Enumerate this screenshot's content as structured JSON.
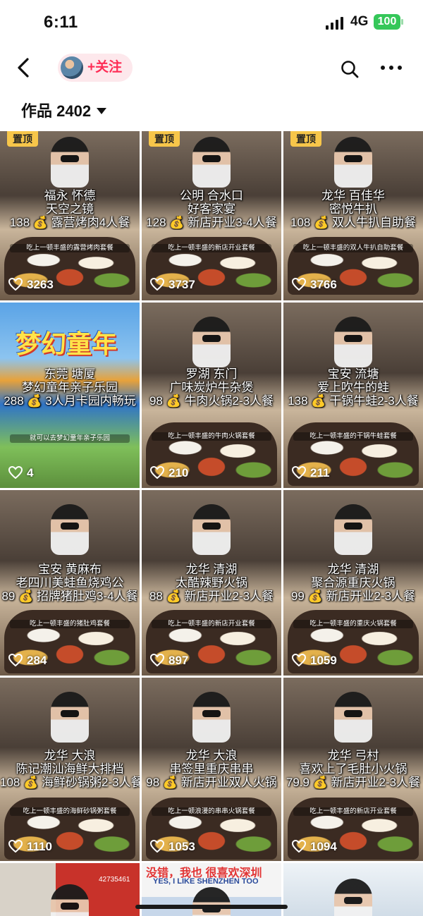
{
  "status_bar": {
    "time": "6:11",
    "network": "4G",
    "battery": "100"
  },
  "nav": {
    "follow_label": "+关注"
  },
  "works": {
    "label": "作品",
    "count": "2402"
  },
  "tiles": [
    {
      "pinned": "置顶",
      "line1": "福永 怀德",
      "line2": "天空之镜",
      "line3": "138 💰 露营烤肉4人餐",
      "subtitle": "吃上一顿丰盛的露营烤肉套餐",
      "likes": "3263"
    },
    {
      "pinned": "置顶",
      "line1": "公明 合水口",
      "line2": "好客家宴",
      "line3": "128 💰 新店开业3-4人餐",
      "subtitle": "吃上一顿丰盛的新店开业套餐",
      "likes": "3737"
    },
    {
      "pinned": "置顶",
      "line1": "龙华 百佳华",
      "line2": "密悦牛扒",
      "line3": "108 💰 双人牛扒自助餐",
      "subtitle": "吃上一顿丰盛的双人牛扒自助套餐",
      "likes": "3766"
    },
    {
      "line1": "东莞 塘厦",
      "line2": "梦幻童年亲子乐园",
      "line3": "288 💰 3人月卡园内畅玩",
      "subtitle": "就可以去梦幻童年亲子乐园",
      "likes": "4",
      "hero_text": "梦幻童年"
    },
    {
      "line1": "罗湖 东门",
      "line2": "广味炭炉牛杂煲",
      "line3": "98 💰 牛肉火锅2-3人餐",
      "subtitle": "吃上一顿丰盛的牛肉火锅套餐",
      "likes": "210"
    },
    {
      "line1": "宝安 流塘",
      "line2": "爱上吹牛的蛙",
      "line3": "138 💰 干锅牛蛙2-3人餐",
      "subtitle": "吃上一顿丰盛的干锅牛蛙套餐",
      "likes": "211"
    },
    {
      "line1": "宝安 黄麻布",
      "line2": "老四川美蛙鱼烧鸡公",
      "line3": "89 💰 招牌猪肚鸡3-4人餐",
      "subtitle": "吃上一顿丰盛的猪肚鸡套餐",
      "likes": "284"
    },
    {
      "line1": "龙华 清湖",
      "line2": "太酷辣野火锅",
      "line3": "88 💰 新店开业2-3人餐",
      "subtitle": "吃上一顿丰盛的新店开业套餐",
      "likes": "897"
    },
    {
      "line1": "龙华 清湖",
      "line2": "聚合源重庆火锅",
      "line3": "99 💰 新店开业2-3人餐",
      "subtitle": "吃上一顿丰盛的重庆火锅套餐",
      "likes": "1059"
    },
    {
      "line1": "龙华 大浪",
      "line2": "陈记潮汕海鲜大排档",
      "line3": "108 💰 海鲜砂锅粥2-3人餐",
      "subtitle": "吃上一顿丰盛的海鲜砂锅粥套餐",
      "likes": "1110"
    },
    {
      "line1": "龙华 大浪",
      "line2": "串签里重庆串串",
      "line3": "98 💰 新店开业双人火锅",
      "subtitle": "吃上一顿浪漫的串串火锅套餐",
      "likes": "1053"
    },
    {
      "line1": "龙华 弓村",
      "line2": "喜欢上了毛肚小火锅",
      "line3": "79.9 💰 新店开业2-3人餐",
      "subtitle": "吃上一顿丰盛的新店开业套餐",
      "likes": "1094"
    },
    {
      "line1": "",
      "line2": "",
      "line3": "",
      "subtitle": "",
      "likes": "",
      "top_text": "42735461"
    },
    {
      "line1": "",
      "line2": "",
      "line3": "",
      "subtitle": "",
      "likes": "",
      "top_text": "没错，我也 很喜欢深圳",
      "top_text2": "YES, I LIKE SHENZHEN TOO"
    },
    {
      "line1": "",
      "line2": "",
      "line3": "",
      "subtitle": "",
      "likes": ""
    }
  ]
}
